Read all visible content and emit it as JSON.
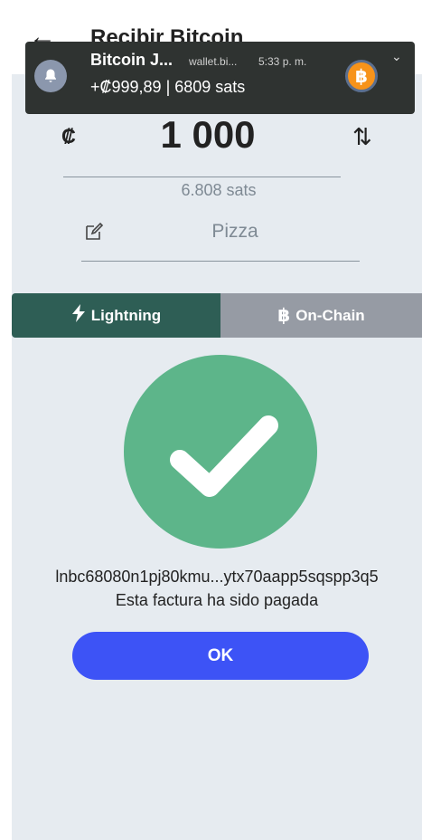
{
  "header": {
    "back_icon": "arrow-left-icon",
    "title": "Recibir Bitcoin"
  },
  "notification": {
    "app_name": "Bitcoin J...",
    "source": "wallet.bi...",
    "time": "5:33 p. m.",
    "body": "+₡999,89 | 6809 sats",
    "icon": "bell-icon",
    "logo": "bitcoin-logo-icon",
    "colors": {
      "background": "#2f3331",
      "bell_bg": "#8b97ad",
      "logo": "#f7931a"
    }
  },
  "amount": {
    "currency_symbol": "₡",
    "value": "1 000",
    "sats": "6.808 sats",
    "swap_icon": "swap-vertical-icon"
  },
  "memo": {
    "icon": "edit-icon",
    "value": "Pizza"
  },
  "tabs": [
    {
      "label": "Lightning",
      "icon": "lightning-icon",
      "active": true
    },
    {
      "label": "On-Chain",
      "icon": "bitcoin-icon",
      "active": false
    }
  ],
  "result": {
    "icon": "check-circle-icon",
    "invoice": "lnbc68080n1pj80kmu...ytx70aapp5sqspp3q5",
    "status": "Esta factura ha sido pagada"
  },
  "ok_button": {
    "label": "OK"
  },
  "colors": {
    "panel": "#e6ebf0",
    "tab_active": "#2e5e55",
    "tab_inactive": "#969ba4",
    "success": "#5db58a",
    "button": "#3d53f6"
  }
}
